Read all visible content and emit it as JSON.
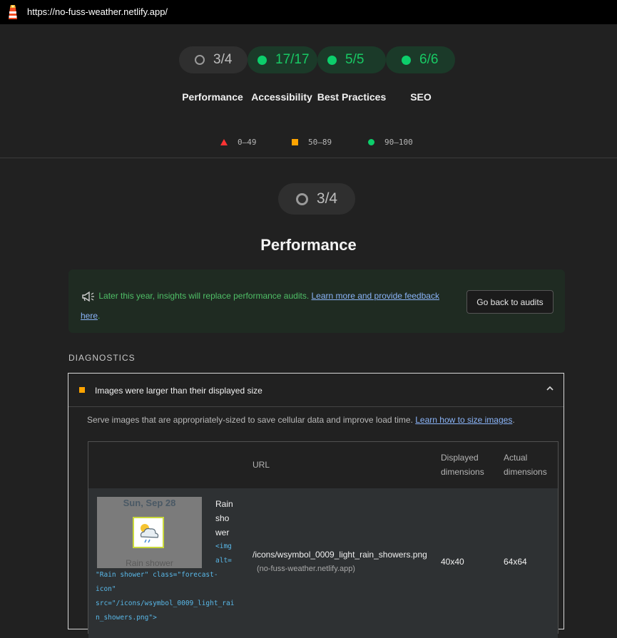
{
  "browser": {
    "url": "https://no-fuss-weather.netlify.app/"
  },
  "summary": {
    "gauges": [
      {
        "score": "3/4",
        "label": "Performance",
        "status": "neutral"
      },
      {
        "score": "17/17",
        "label": "Accessibility",
        "status": "pass"
      },
      {
        "score": "5/5",
        "label": "Best Practices",
        "status": "pass"
      },
      {
        "score": "6/6",
        "label": "SEO",
        "status": "pass"
      }
    ],
    "legend": [
      {
        "range": "0–49",
        "color": "#ff3333"
      },
      {
        "range": "50–89",
        "color": "#ffa400"
      },
      {
        "range": "90–100",
        "color": "#0cce6b"
      }
    ]
  },
  "category": {
    "score": "3/4",
    "title": "Performance",
    "notice": {
      "text": "Later this year, insights will replace performance audits.",
      "link_text": "Learn more and provide feedback here",
      "link_part1": "Learn more and provide feedback",
      "link_part2": "here",
      "button": "Go back to audits"
    }
  },
  "diagnostics": {
    "heading": "DIAGNOSTICS",
    "audit": {
      "title": "Images were larger than their displayed size",
      "status_color": "#ffa400",
      "description": "Serve images that are appropriately-sized to save cellular data and improve load time.",
      "learn_link": "Learn how to size images",
      "table": {
        "headers": {
          "url": "URL",
          "displayed_1": "Displayed",
          "displayed_2": "dimensions",
          "actual_1": "Actual",
          "actual_2": "dimensions"
        },
        "rows": [
          {
            "thumb_date": "Sun, Sep 28",
            "thumb_caption": "Rain shower",
            "node_label_1": "Rain",
            "node_label_2": "sho",
            "node_label_3": "wer",
            "snippet_1": "<img",
            "snippet_2": "alt=",
            "snippet_3": "\"Rain shower\" class=\"forecast-",
            "snippet_4": "icon\"",
            "snippet_5": "src=\"/icons/wsymbol_0009_light_rai",
            "snippet_6": "n_showers.png\">",
            "url": "/icons/wsymbol_0009_light_rain_showers.png",
            "host": "(no-fuss-weather.netlify.app)",
            "displayed": "40x40",
            "actual": "64x64"
          }
        ]
      }
    }
  }
}
